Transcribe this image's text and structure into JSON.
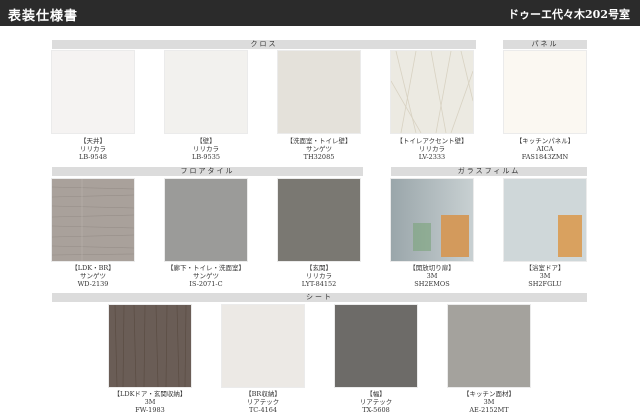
{
  "header": {
    "title": "表装仕様書",
    "property": "ドゥーエ代々木202号室"
  },
  "sections": {
    "cloth": "クロス",
    "panel": "パネル",
    "floor_tile": "フロアタイル",
    "glass_film": "ガラスフィルム",
    "sheet": "シート"
  },
  "items": [
    {
      "location": "【天井】",
      "maker": "リリカラ",
      "code": "LB-9548",
      "color": "#f5f3f2"
    },
    {
      "location": "【壁】",
      "maker": "リリカラ",
      "code": "LB-9535",
      "color": "#f2f1ee"
    },
    {
      "location": "【洗面室・トイレ壁】",
      "maker": "サンゲツ",
      "code": "TH32085",
      "color": "#e4e1da"
    },
    {
      "location": "【トイレアクセント壁】",
      "maker": "リリカラ",
      "code": "LV-2333",
      "color": "#eceae2"
    },
    {
      "location": "【キッチンパネル】",
      "maker": "AICA",
      "code": "FAS1843ZMN",
      "color": "#fbf8f2"
    },
    {
      "location": "【LDK・BR】",
      "maker": "サンゲツ",
      "code": "WD-2139",
      "color": "#a9a19b"
    },
    {
      "location": "【廊下・トイレ・洗面室】",
      "maker": "サンゲツ",
      "code": "IS-2071-C",
      "color": "#9b9b99"
    },
    {
      "location": "【玄関】",
      "maker": "リリカラ",
      "code": "LYT-84152",
      "color": "#7a7872"
    },
    {
      "location": "【開放切り扉】",
      "maker": "3M",
      "code": "SH2EMOS",
      "color": "#b9c3c6"
    },
    {
      "location": "【浴室ドア】",
      "maker": "3M",
      "code": "SH2FGLU",
      "color": "#d3dadc"
    },
    {
      "location": "【LDKドア・玄関収納】",
      "maker": "3M",
      "code": "FW-1983",
      "color": "#6a5d56"
    },
    {
      "location": "【BR収納】",
      "maker": "リアテック",
      "code": "TC-4164",
      "color": "#ece9e5"
    },
    {
      "location": "【幅】",
      "maker": "リアテック",
      "code": "TX-5608",
      "color": "#6d6b68"
    },
    {
      "location": "【キッチン面材】",
      "maker": "3M",
      "code": "AE-2152MT",
      "color": "#a4a29d"
    }
  ]
}
